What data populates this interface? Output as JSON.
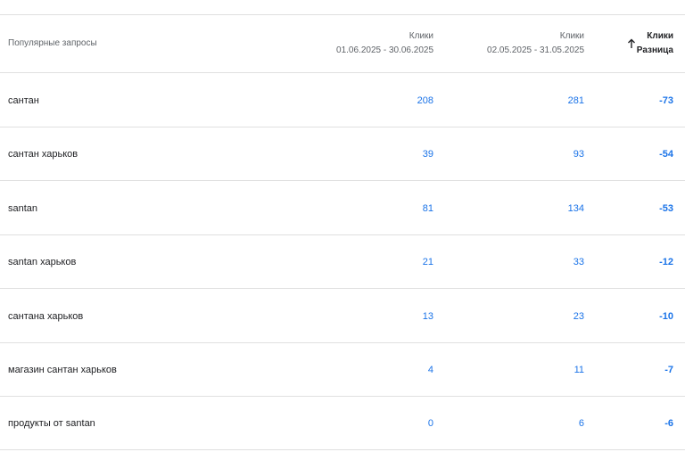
{
  "header": {
    "query_label": "Популярные запросы",
    "col_a": {
      "title": "Клики",
      "range": "01.06.2025 - 30.06.2025"
    },
    "col_b": {
      "title": "Клики",
      "range": "02.05.2025 - 31.05.2025"
    },
    "col_diff": {
      "title": "Клики",
      "subtitle": "Разница",
      "sort_icon": "arrow-up-icon"
    }
  },
  "rows": [
    {
      "query": "сантан",
      "a": "208",
      "b": "281",
      "diff": "-73"
    },
    {
      "query": "сантан харьков",
      "a": "39",
      "b": "93",
      "diff": "-54"
    },
    {
      "query": "santan",
      "a": "81",
      "b": "134",
      "diff": "-53"
    },
    {
      "query": "santan харьков",
      "a": "21",
      "b": "33",
      "diff": "-12"
    },
    {
      "query": "сантана харьков",
      "a": "13",
      "b": "23",
      "diff": "-10"
    },
    {
      "query": "магазин сантан харьков",
      "a": "4",
      "b": "11",
      "diff": "-7"
    },
    {
      "query": "продукты от santan",
      "a": "0",
      "b": "6",
      "diff": "-6"
    }
  ],
  "colors": {
    "link": "#1a73e8",
    "text": "#202124",
    "muted": "#5f6368",
    "divider": "#e0e0e0"
  }
}
